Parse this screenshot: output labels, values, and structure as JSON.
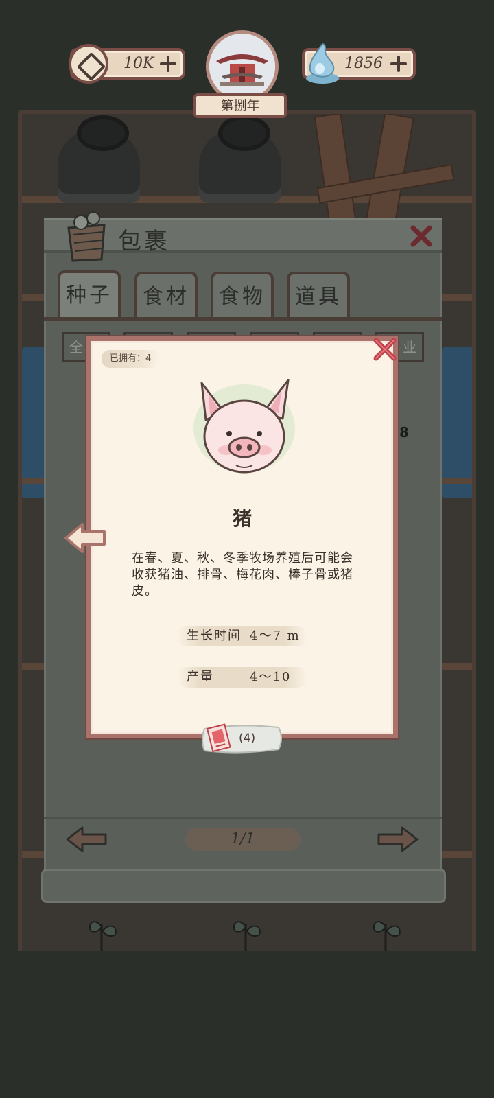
{
  "resources": {
    "coins": "10K",
    "spirit": "1856"
  },
  "season": {
    "year_label": "第捌年"
  },
  "bag": {
    "title": "包裹",
    "tabs": [
      {
        "label": "种子",
        "active": true
      },
      {
        "label": "食材",
        "active": false
      },
      {
        "label": "食物",
        "active": false
      },
      {
        "label": "道具",
        "active": false
      }
    ],
    "filters_visible": [
      "全",
      "业"
    ],
    "side_count": "8",
    "page": "1/1"
  },
  "detail": {
    "owned": "已拥有：4",
    "name": "猪",
    "description": "在春、夏、秋、冬季牧场养殖后可能会收获猪油、排骨、梅花肉、棒子骨或猪皮。",
    "growth_label": "生长时间",
    "growth_value": "4～7 m",
    "yield_label": "产量",
    "yield_value": "4～10",
    "ticket_count": "(4)"
  },
  "colors": {
    "card_border": "#a9736b",
    "card_bg": "#fbf3e6",
    "close_red": "#c0414a",
    "frame_brown": "#7b4d47"
  },
  "icons": {
    "coin": "coin-icon",
    "spirit": "spirit-flame-icon",
    "bag": "basket-icon",
    "close": "close-x-icon",
    "arrow_left": "arrow-left-icon",
    "arrow_right": "arrow-right-icon",
    "ticket": "ticket-icon",
    "pig": "pig-icon"
  }
}
